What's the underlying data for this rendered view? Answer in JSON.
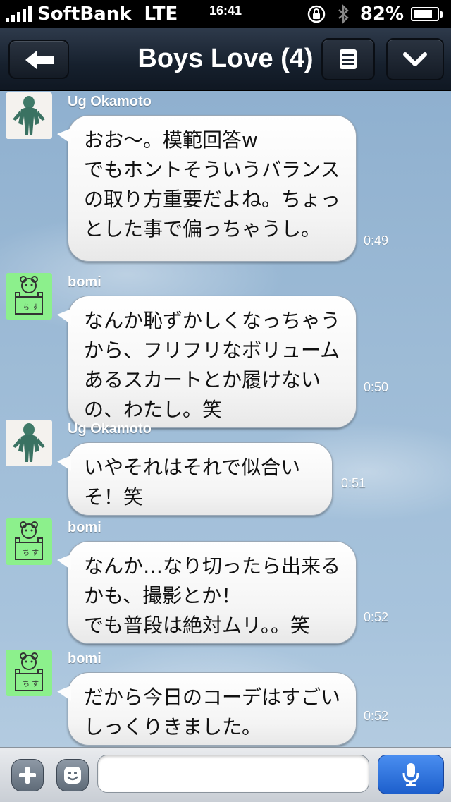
{
  "status_bar": {
    "carrier": "SoftBank",
    "network": "LTE",
    "time": "16:41",
    "battery": "82%",
    "battery_level": 0.82
  },
  "nav": {
    "title": "Boys Love (4)",
    "back_icon": "back-arrow-icon",
    "menu_icon": "menu-list-icon",
    "dropdown_icon": "chevron-down-icon"
  },
  "messages": [
    {
      "sender": "Ug Okamoto",
      "text": "おお〜。模範回答w\nでもホントそういうバランスの取り方重要だよね。ちょっとした事で偏っちゃうし。",
      "time": "0:49"
    },
    {
      "sender": "bomi",
      "text": "なんか恥ずかしくなっちゃうから、フリフリなボリュームあるスカートとか履けないの、わたし。笑",
      "time": "0:50"
    },
    {
      "sender": "Ug Okamoto",
      "text": "いやそれはそれで似合いそ！笑",
      "time": "0:51"
    },
    {
      "sender": "bomi",
      "text": "なんか…なり切ったら出来るかも、撮影とか！\nでも普段は絶対ムリ。。笑",
      "time": "0:52"
    },
    {
      "sender": "bomi",
      "text": "だから今日のコーデはすごいしっくりきました。",
      "time": "0:52"
    }
  ],
  "input_bar": {
    "placeholder": "",
    "value": "",
    "add_icon": "plus-icon",
    "sticker_icon": "smiley-icon",
    "mic_icon": "microphone-icon"
  },
  "colors": {
    "nav_bg": "#16202d",
    "chat_bg": "#9dbbd6",
    "avatar_bomi_bg": "#8cf08c",
    "mic_button": "#2f72dc"
  }
}
